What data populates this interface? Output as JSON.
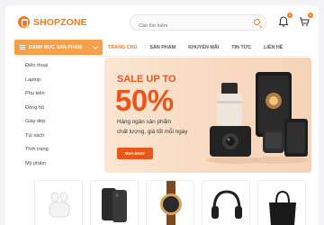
{
  "header": {
    "brand": "SHOPZONE",
    "search_placeholder": "Cần tìm kiếm",
    "notification_count": "0",
    "cart_count": "0"
  },
  "nav": {
    "category_button": "DANH MỤC SẢN PHẨM",
    "links": [
      "TRANG CHỦ",
      "SẢN PHẨM",
      "KHUYẾN MÃI",
      "TIN TỨC",
      "LIÊN HỆ"
    ]
  },
  "sidebar": {
    "items": [
      "Điện thoại",
      "Laptop",
      "Phụ kiện",
      "Đồng hồ",
      "Giày dép",
      "Túi xách",
      "Thời trang",
      "Mỹ phẩm"
    ]
  },
  "banner": {
    "headline": "SALE UP TO",
    "percent": "50%",
    "line1": "Hàng ngàn sản phẩm",
    "line2": "chất lượng, giá tốt mỗi ngày",
    "cta": "MUA NGAY"
  },
  "colors": {
    "accent": "#f47a1f",
    "sale_red": "#e8561c",
    "banner_bg": "#f8dcc4"
  }
}
